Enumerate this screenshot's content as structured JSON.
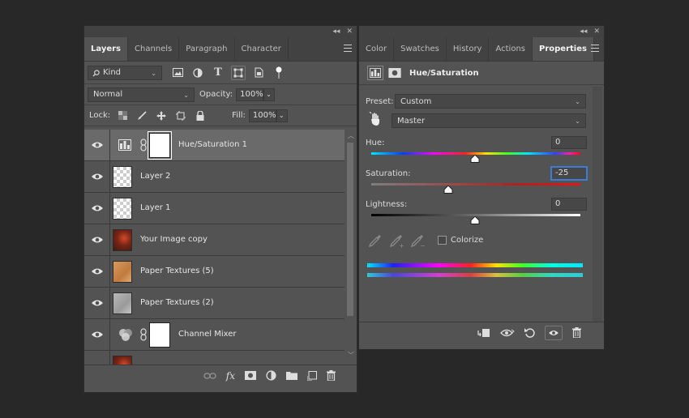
{
  "layers_panel": {
    "top_controls": [
      "◂◂",
      "✕"
    ],
    "tabs": [
      {
        "label": "Layers",
        "active": true
      },
      {
        "label": "Channels",
        "active": false
      },
      {
        "label": "Paragraph",
        "active": false
      },
      {
        "label": "Character",
        "active": false
      }
    ],
    "filter": {
      "label": "Kind",
      "icon": "search-icon"
    },
    "blend_mode": "Normal",
    "opacity_label": "Opacity:",
    "opacity_value": "100%",
    "lock_label": "Lock:",
    "fill_label": "Fill:",
    "fill_value": "100%",
    "layers": [
      {
        "name": "Hue/Saturation 1",
        "selected": true
      },
      {
        "name": "Layer 2"
      },
      {
        "name": "Layer 1"
      },
      {
        "name": "Your Image copy"
      },
      {
        "name": "Paper Textures (5)"
      },
      {
        "name": "Paper Textures (2)"
      },
      {
        "name": "Channel Mixer"
      },
      {
        "name": ""
      }
    ],
    "footer_fx": "fx"
  },
  "properties_panel": {
    "top_controls": [
      "◂◂",
      "✕"
    ],
    "tabs": [
      {
        "label": "Color",
        "active": false
      },
      {
        "label": "Swatches",
        "active": false
      },
      {
        "label": "History",
        "active": false
      },
      {
        "label": "Actions",
        "active": false
      },
      {
        "label": "Properties",
        "active": true
      }
    ],
    "title": "Hue/Saturation",
    "preset_label": "Preset:",
    "preset_value": "Custom",
    "channel_value": "Master",
    "hue_label": "Hue:",
    "hue_value": "0",
    "saturation_label": "Saturation:",
    "saturation_value": "-25",
    "lightness_label": "Lightness:",
    "lightness_value": "0",
    "colorize_label": "Colorize",
    "colorize_checked": false
  },
  "colors": {
    "panel_bg": "#535353",
    "tab_bg": "#424242",
    "selected_layer": "#6a6a6a",
    "focus_outline": "#3d7bd4"
  }
}
